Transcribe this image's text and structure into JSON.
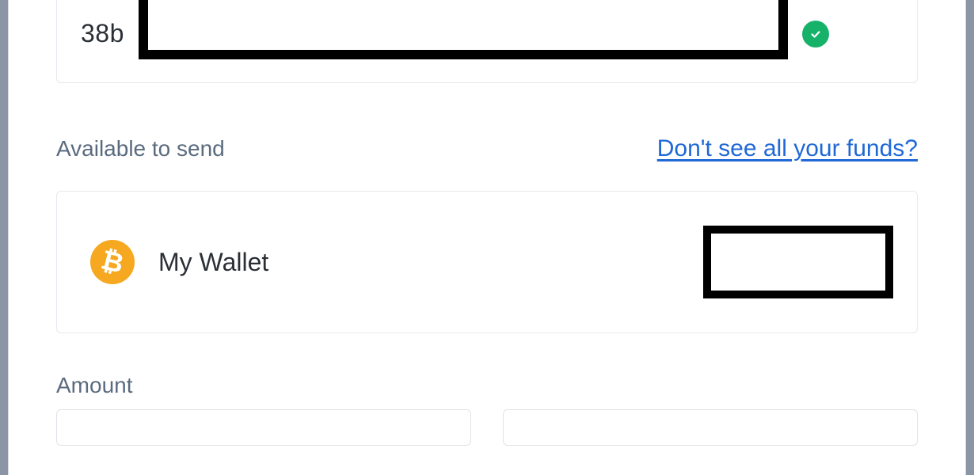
{
  "address": {
    "prefix": "38b",
    "valid": true
  },
  "available": {
    "label": "Available to send",
    "help_link": "Don't see all your funds?"
  },
  "wallet": {
    "name": "My Wallet",
    "asset": "BTC",
    "asset_symbol": "₿"
  },
  "amount": {
    "label": "Amount",
    "value_left": "",
    "value_right": ""
  },
  "colors": {
    "brand_btc": "#f6a821",
    "success": "#17b26a",
    "link": "#1f68d6",
    "text": "#2a2f36",
    "muted": "#5b6b7f",
    "border": "#e5e9ed"
  }
}
